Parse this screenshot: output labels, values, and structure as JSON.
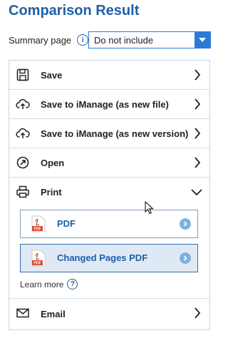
{
  "title": "Comparison Result",
  "summary": {
    "label": "Summary page",
    "info_icon": "i",
    "selected": "Do not include"
  },
  "actions": {
    "save": "Save",
    "save_imanage_new_file": "Save to iManage (as new file)",
    "save_imanage_new_version": "Save to iManage (as new version)",
    "open": "Open",
    "print": "Print",
    "email": "Email"
  },
  "print_options": {
    "pdf_icon_text": "PDF",
    "pdf": "PDF",
    "changed_pages_pdf": "Changed Pages PDF"
  },
  "learn_more": {
    "label": "Learn more",
    "icon": "?"
  },
  "colors": {
    "accent": "#1f5fa8",
    "dropdown": "#2b7bd6",
    "pdf_red": "#d64b35"
  }
}
